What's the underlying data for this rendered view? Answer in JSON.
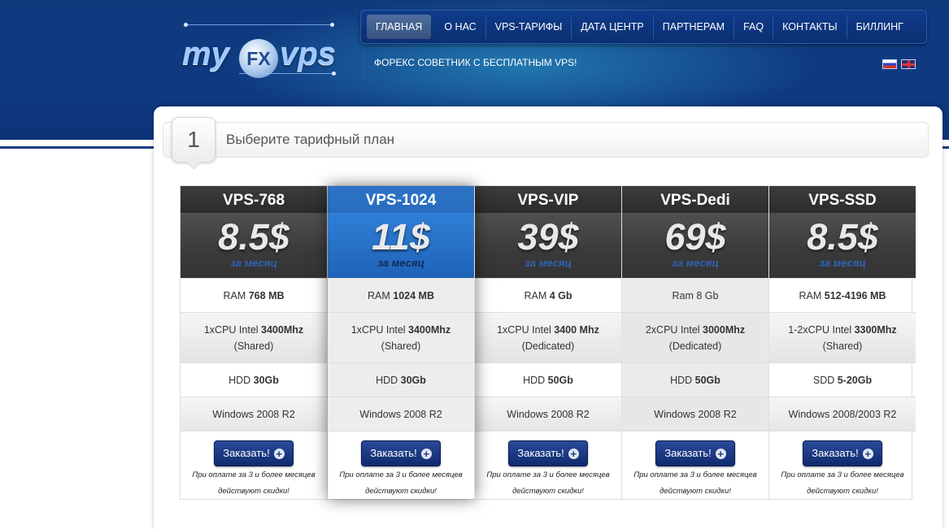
{
  "logo": {
    "left": "my",
    "center": "FX",
    "right": "vps"
  },
  "nav": {
    "items": [
      "ГЛАВНАЯ",
      "О НАС",
      "VPS-ТАРИФЫ",
      "ДАТА ЦЕНТР",
      "ПАРТНЕРАМ",
      "FAQ",
      "КОНТАКТЫ",
      "БИЛЛИНГ"
    ],
    "active_index": 0
  },
  "slogan": "ФОРЕКС СОВЕТНИК С БЕСПЛАТНЫМ VPS!",
  "languages": [
    "ru-flag",
    "en-flag"
  ],
  "step": {
    "number": "1",
    "title": "Выберите тарифный план"
  },
  "per_month": "за месяц",
  "order_button": "Заказать!",
  "discount_note_line1": "При оплате за 3 и более месяцев",
  "discount_note_line2": "действуют скидки!",
  "colors": {
    "header": "#0f3a82",
    "highlight": "#1d5cab",
    "button": "#0f2a6e"
  },
  "plans": [
    {
      "name": "VPS-768",
      "price": "8.5$",
      "ram_pre": "RAM ",
      "ram_val": "768 MB",
      "cpu_pre": "1xCPU Intel ",
      "cpu_val": "3400Mhz",
      "cpu_type": "(Shared)",
      "disk_pre": "HDD ",
      "disk_val": "30Gb",
      "os": "Windows 2008 R2"
    },
    {
      "name": "VPS-1024",
      "price": "11$",
      "ram_pre": "RAM ",
      "ram_val": "1024 MB",
      "cpu_pre": "1xCPU Intel ",
      "cpu_val": "3400Mhz",
      "cpu_type": "(Shared)",
      "disk_pre": "HDD ",
      "disk_val": "30Gb",
      "os": "Windows 2008 R2"
    },
    {
      "name": "VPS-VIP",
      "price": "39$",
      "ram_pre": "RAM ",
      "ram_val": "4 Gb",
      "cpu_pre": "1xCPU Intel ",
      "cpu_val": "3400 Mhz",
      "cpu_type": "(Dedicated)",
      "disk_pre": "HDD ",
      "disk_val": "50Gb",
      "os": "Windows 2008 R2"
    },
    {
      "name": "VPS-Dedi",
      "price": "69$",
      "ram_pre": "Ram ",
      "ram_val": "8 Gb",
      "cpu_pre": "2xCPU Intel ",
      "cpu_val": "3000Mhz",
      "cpu_type": "(Dedicated)",
      "disk_pre": "HDD ",
      "disk_val": "50Gb",
      "os": "Windows 2008 R2"
    },
    {
      "name": "VPS-SSD",
      "price": "8.5$",
      "ram_pre": "RAM ",
      "ram_val": "512-4196 MB",
      "cpu_pre": "1-2xCPU Intel ",
      "cpu_val": "3300Mhz",
      "cpu_type": "(Shared)",
      "disk_pre": "SDD ",
      "disk_val": "5-20Gb",
      "os": "Windows 2008/2003 R2"
    }
  ]
}
